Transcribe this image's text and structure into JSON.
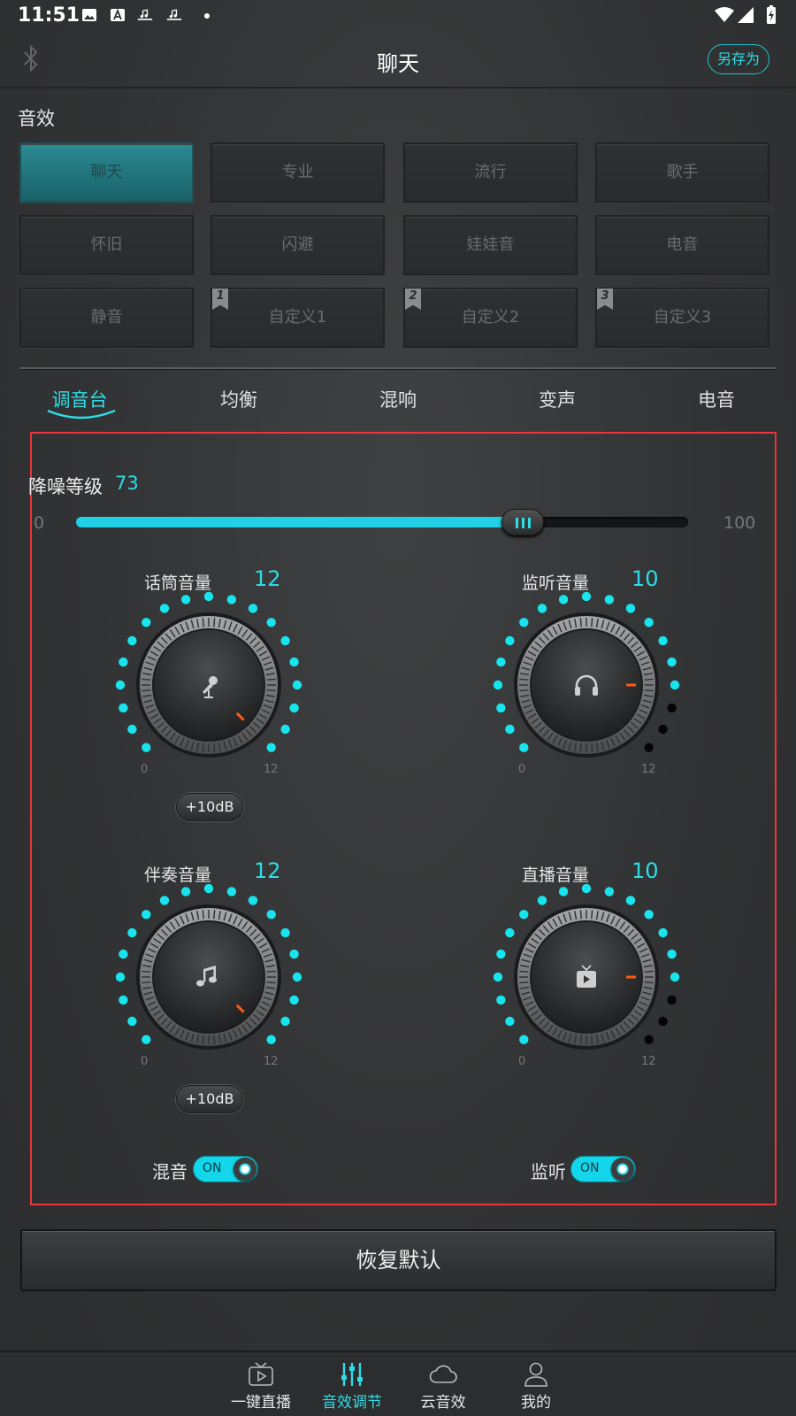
{
  "status_bar": {
    "time": "11:51"
  },
  "header": {
    "title": "聊天",
    "save_as": "另存为"
  },
  "presets": {
    "section_label": "音效",
    "items": [
      {
        "label": "聊天",
        "active": true,
        "flag": ""
      },
      {
        "label": "专业",
        "active": false,
        "flag": ""
      },
      {
        "label": "流行",
        "active": false,
        "flag": ""
      },
      {
        "label": "歌手",
        "active": false,
        "flag": ""
      },
      {
        "label": "怀旧",
        "active": false,
        "flag": ""
      },
      {
        "label": "闪避",
        "active": false,
        "flag": ""
      },
      {
        "label": "娃娃音",
        "active": false,
        "flag": ""
      },
      {
        "label": "电音",
        "active": false,
        "flag": ""
      },
      {
        "label": "静音",
        "active": false,
        "flag": ""
      },
      {
        "label": "自定义1",
        "active": false,
        "flag": "1"
      },
      {
        "label": "自定义2",
        "active": false,
        "flag": "2"
      },
      {
        "label": "自定义3",
        "active": false,
        "flag": "3"
      }
    ]
  },
  "tabs": [
    {
      "label": "调音台",
      "active": true
    },
    {
      "label": "均衡",
      "active": false
    },
    {
      "label": "混响",
      "active": false
    },
    {
      "label": "变声",
      "active": false
    },
    {
      "label": "电音",
      "active": false
    }
  ],
  "noise_reduction": {
    "label": "降噪等级",
    "value": 73,
    "min": "0",
    "max": "100"
  },
  "knobs": [
    {
      "label": "话筒音量",
      "value": 12,
      "max_value": 12,
      "min_label": "0",
      "max_label": "12",
      "icon": "microphone-icon",
      "boost": "+10dB"
    },
    {
      "label": "监听音量",
      "value": 10,
      "max_value": 12,
      "min_label": "0",
      "max_label": "12",
      "icon": "headphones-icon",
      "boost": ""
    },
    {
      "label": "伴奏音量",
      "value": 12,
      "max_value": 12,
      "min_label": "0",
      "max_label": "12",
      "icon": "music-note-icon",
      "boost": "+10dB"
    },
    {
      "label": "直播音量",
      "value": 10,
      "max_value": 12,
      "min_label": "0",
      "max_label": "12",
      "icon": "tv-play-icon",
      "boost": ""
    }
  ],
  "toggles": [
    {
      "label": "混音",
      "state": "ON"
    },
    {
      "label": "监听",
      "state": "ON"
    }
  ],
  "reset_label": "恢复默认",
  "bottom_nav": [
    {
      "label": "一键直播",
      "icon": "tv-icon",
      "active": false
    },
    {
      "label": "音效调节",
      "icon": "sliders-icon",
      "active": true
    },
    {
      "label": "云音效",
      "icon": "cloud-icon",
      "active": false
    },
    {
      "label": "我的",
      "icon": "user-icon",
      "active": false
    }
  ],
  "colors": {
    "accent": "#2fdce6",
    "active_preset": "#1f7178",
    "panel_outline": "#e8353f",
    "indicator": "#ff5a14"
  }
}
